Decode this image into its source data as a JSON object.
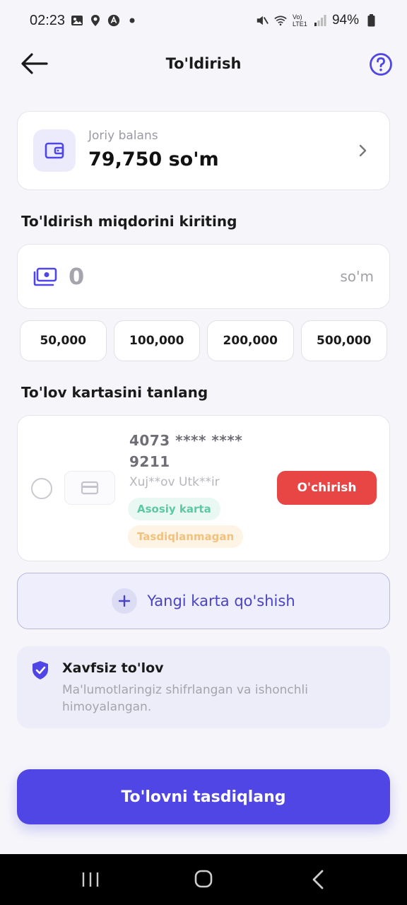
{
  "status_bar": {
    "time": "02:23",
    "battery": "94%",
    "network": "Vo) LTE1"
  },
  "header": {
    "title": "To'ldirish"
  },
  "balance": {
    "label": "Joriy balans",
    "value": "79,750 so'm"
  },
  "amount_section": {
    "title": "To'ldirish miqdorini kiriting",
    "value": "0",
    "unit": "so'm",
    "quick_amounts": [
      "50,000",
      "100,000",
      "200,000",
      "500,000"
    ]
  },
  "card_section": {
    "title": "To'lov kartasini tanlang",
    "card": {
      "number": "4073 **** **** 9211",
      "holder": "Xuj**ov Utk**ir",
      "badge_main": "Asosiy karta",
      "badge_status": "Tasdiqlanmagan",
      "delete_label": "O'chirish"
    },
    "add_card_label": "Yangi karta qo'shish"
  },
  "secure": {
    "title": "Xavfsiz to'lov",
    "text": "Ma'lumotlaringiz shifrlangan va ishonchli himoyalangan."
  },
  "confirm_label": "To'lovni tasdiqlang",
  "colors": {
    "accent": "#4f46e5",
    "danger": "#e84545",
    "success_text": "#5cc8a4",
    "warning_text": "#f1c17e"
  }
}
